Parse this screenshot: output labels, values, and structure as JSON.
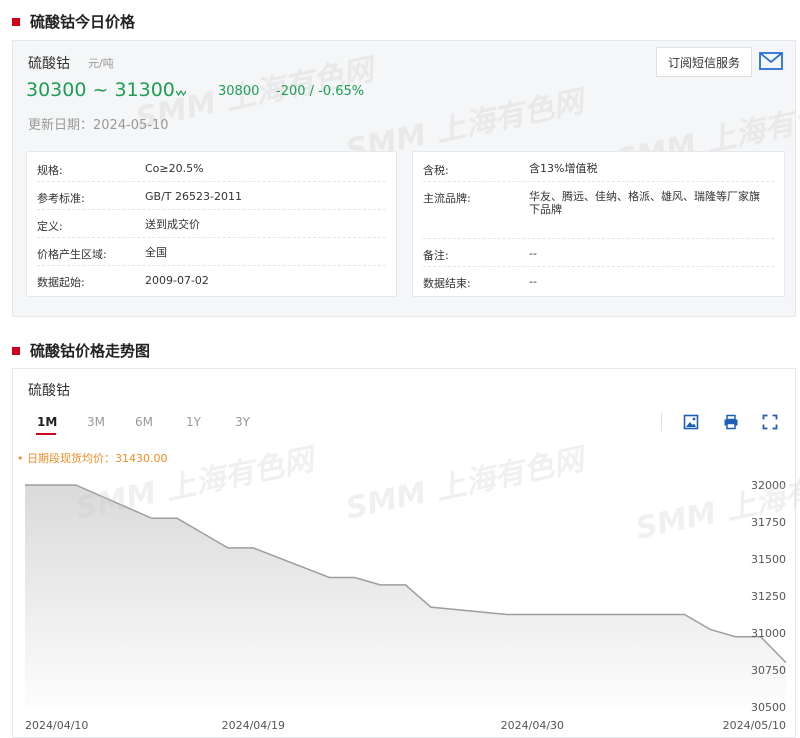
{
  "section1": {
    "title": "硫酸钴今日价格"
  },
  "section2": {
    "title": "硫酸钴价格走势图"
  },
  "price": {
    "product": "硫酸钴",
    "unit": "元/吨",
    "range": "30300 ~ 31300",
    "trend_icon": "wave-down-icon",
    "average": "30800",
    "change": "-200 / -0.65%",
    "update": "更新日期：2024-05-10",
    "subscribe_label": "订阅短信服务"
  },
  "info_left": [
    {
      "label": "规格:",
      "value": "Co≥20.5%"
    },
    {
      "label": "参考标准:",
      "value": "GB/T 26523-2011"
    },
    {
      "label": "定义:",
      "value": "送到成交价"
    },
    {
      "label": "价格产生区域:",
      "value": "全国"
    },
    {
      "label": "数据起始:",
      "value": "2009-07-02"
    }
  ],
  "info_right": [
    {
      "label": "含税:",
      "value": "含13%增值税"
    },
    {
      "label": "主流品牌:",
      "value": "华友、腾远、佳纳、格派、雄风、瑞隆等厂家旗下品牌"
    },
    {
      "label": "备注:",
      "value": "--"
    },
    {
      "label": "数据结束:",
      "value": "--"
    }
  ],
  "watermark": "SMM 上海有色网",
  "chart_panel": {
    "product": "硫酸钴",
    "tabs": [
      "1M",
      "3M",
      "6M",
      "1Y",
      "3Y"
    ],
    "active_tab": "1M",
    "tools": [
      "save-image-icon",
      "print-icon",
      "fullscreen-icon"
    ]
  },
  "colors": {
    "accent": "#d0021b",
    "down": "#1e9e54",
    "legend": "#f08c28",
    "line": "#9e9e9e"
  },
  "chart_data": {
    "type": "area",
    "legend": "日期段现货均价：31430.00",
    "x_tick_labels": [
      "2024/04/10",
      "2024/04/19",
      "2024/04/30",
      "2024/05/10"
    ],
    "y_ticks": [
      32000,
      31750,
      31500,
      31250,
      31000,
      30750,
      30500
    ],
    "ylim": [
      30500,
      32000
    ],
    "xlim": [
      "2024-04-10",
      "2024-05-10"
    ],
    "series": [
      {
        "x": [
          "2024-04-10",
          "2024-04-12",
          "2024-04-15",
          "2024-04-16",
          "2024-04-17",
          "2024-04-18",
          "2024-04-19",
          "2024-04-22",
          "2024-04-23",
          "2024-04-24",
          "2024-04-25",
          "2024-04-26",
          "2024-04-29",
          "2024-04-30",
          "2024-05-06",
          "2024-05-07",
          "2024-05-08",
          "2024-05-09",
          "2024-05-10"
        ],
        "values": [
          32000,
          32000,
          31775,
          31775,
          31675,
          31575,
          31575,
          31375,
          31375,
          31325,
          31325,
          31175,
          31125,
          31125,
          31125,
          31025,
          30975,
          30975,
          30800
        ]
      }
    ],
    "grid": false,
    "legend_position": "top-left"
  }
}
